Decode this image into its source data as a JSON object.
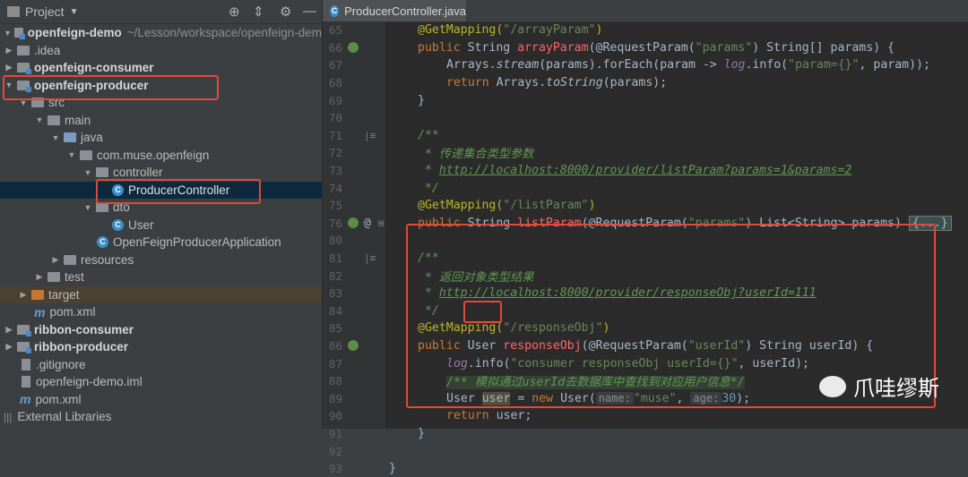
{
  "project": {
    "title": "Project",
    "items": [
      {
        "label": "openfeign-demo",
        "path": "~/Lesson/workspace/openfeign-dem"
      },
      {
        "label": ".idea"
      },
      {
        "label": "openfeign-consumer"
      },
      {
        "label": "openfeign-producer"
      },
      {
        "label": "src"
      },
      {
        "label": "main"
      },
      {
        "label": "java"
      },
      {
        "label": "com.muse.openfeign"
      },
      {
        "label": "controller"
      },
      {
        "label": "ProducerController"
      },
      {
        "label": "dto"
      },
      {
        "label": "User"
      },
      {
        "label": "OpenFeignProducerApplication"
      },
      {
        "label": "resources"
      },
      {
        "label": "test"
      },
      {
        "label": "target"
      },
      {
        "label": "pom.xml"
      },
      {
        "label": "ribbon-consumer"
      },
      {
        "label": "ribbon-producer"
      },
      {
        "label": ".gitignore"
      },
      {
        "label": "openfeign-demo.iml"
      },
      {
        "label": "pom.xml"
      },
      {
        "label": "External Libraries"
      }
    ]
  },
  "editor": {
    "tab": "ProducerController.java",
    "line_numbers": [
      "65",
      "66",
      "67",
      "68",
      "69",
      "70",
      "71",
      "72",
      "73",
      "74",
      "75",
      "76",
      "80",
      "81",
      "82",
      "83",
      "84",
      "85",
      "86",
      "87",
      "88",
      "89",
      "90",
      "91",
      "92",
      "93"
    ],
    "l65": {
      "a": "@GetMapping(",
      "s": "\"/arrayParam\"",
      "b": ")"
    },
    "l66": {
      "kw": "public ",
      "t": "String ",
      "fn": "arrayParam",
      "a": "(@RequestParam(",
      "s": "\"params\"",
      "b": ") String[] params) {"
    },
    "l67": {
      "a": "Arrays.",
      "i": "stream",
      "b": "(params).forEach(param -> ",
      "log": "log",
      "c": ".info(",
      "s": "\"param={}\"",
      "d": ", param));"
    },
    "l68": {
      "kw": "return ",
      "a": "Arrays.",
      "i": "toString",
      "b": "(params);"
    },
    "l69": {
      "t": "}"
    },
    "l71": {
      "t": "/**"
    },
    "l72": {
      "t": " * 传递集合类型参数"
    },
    "l73": {
      "p": " * ",
      "u": "http://localhost:8000/provider/listParam?params=1&params=2"
    },
    "l74": {
      "t": " */"
    },
    "l75": {
      "a": "@GetMapping(",
      "s": "\"/listParam\"",
      "b": ")"
    },
    "l76": {
      "kw": "public ",
      "t": "String ",
      "fn": "listParam",
      "a": "(@RequestParam(",
      "s": "\"params\"",
      "b": ") List<String> params) ",
      "f": "{...}"
    },
    "l81": {
      "t": "/**"
    },
    "l82": {
      "t": " * 返回对象类型结果"
    },
    "l83": {
      "p": " * ",
      "u": "http://localhost:8000/provider/responseObj?userId=111"
    },
    "l84": {
      "t": " */"
    },
    "l85": {
      "a": "@GetMapping(",
      "s": "\"/responseObj\"",
      "b": ")"
    },
    "l86": {
      "kw": "public ",
      "t": "User",
      "sp": " ",
      "fn": "responseObj",
      "a": "(@RequestParam(",
      "s": "\"userId\"",
      "b": ") String userId) {"
    },
    "l87": {
      "log": "log",
      "c": ".info(",
      "s": "\"consumer responseObj userId={}\"",
      "d": ", userId);"
    },
    "l88": {
      "t": "/** 模拟通过userId去数据库中查找到对应用户信息*/"
    },
    "l89": {
      "a": "User ",
      "u": "user",
      "b": " = ",
      "kw": "new ",
      "c": "User(",
      "h1": "name:",
      "s": "\"muse\"",
      "d": ", ",
      "h2": "age:",
      "n": "30",
      "e": ");"
    },
    "l90": {
      "kw": "return ",
      "t": "user;"
    },
    "l91": {
      "t": "}"
    },
    "l93": {
      "t": "}"
    }
  },
  "watermark": "爪哇缪斯"
}
